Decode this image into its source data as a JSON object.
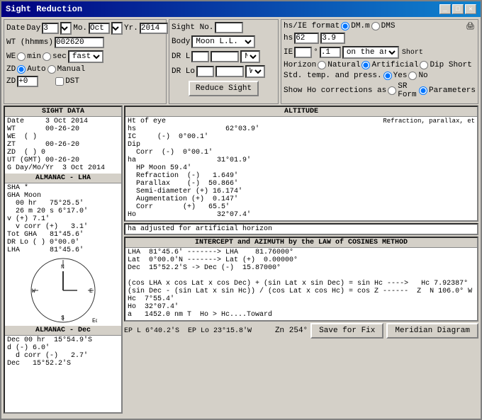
{
  "window": {
    "title": "Sight Reduction"
  },
  "form": {
    "date_label": "Date",
    "day_label": "Day",
    "day_value": "3",
    "mo_label": "Mo.",
    "mo_value": "Oct",
    "yr_label": "Yr.",
    "yr_value": "2014",
    "wt_label": "WT (hhmms)",
    "wt_value": "002620",
    "we_label": "WE",
    "min_label": "min",
    "sec_label": "sec",
    "fast_label": "fast",
    "zd_label": "ZD",
    "auto_label": "Auto",
    "manual_label": "Manual",
    "zd2_label": "ZD",
    "zd_value": "+0",
    "dst_label": "DST",
    "sight_no_label": "Sight No.",
    "body_label": "Body",
    "body_value": "Moon L.L.",
    "dr_l_label": "DR L",
    "dr_l_deg": "",
    "dr_l_dir": "N",
    "dr_lo_label": "DR Lo",
    "dr_lo_dir": "W",
    "reduce_btn": "Reduce Sight"
  },
  "hs_ie": {
    "format_label": "hs/IE format",
    "dm_m_label": "DM.m",
    "dms_label": "DMS",
    "hs_label": "hs",
    "hs_value": "62",
    "ie_deg": "",
    "ie_val": ".1",
    "on_arc_label": "on the arc",
    "short_label": "Short",
    "horizon_label": "Horizon",
    "natural_label": "Natural",
    "artificial_label": "Artificial",
    "dip_short_label": "Dip Short",
    "std_temp_label": "Std. temp. and press.",
    "yes_label": "Yes",
    "no_label": "No",
    "show_ho_label": "Show Ho corrections as",
    "sr_form_label": "SR Form",
    "parameters_label": "Parameters"
  },
  "sight_data": {
    "title": "SIGHT DATA",
    "date_label": "Date",
    "date_value": "3 Oct 2014",
    "wt_label": "WT",
    "wt_value": "00-26-20",
    "we_label": "WE",
    "we_value": "( )",
    "zt_label": "ZT",
    "zt_value": "00-26-20",
    "zd_label": "ZD",
    "zd_value": "( ) 0",
    "ut_label": "UT (GMT)",
    "ut_value": "00-26-20",
    "g_label": "G Day/Mo/Yr",
    "g_value": "3 Oct 2014"
  },
  "almanac_lha": {
    "title": "ALMANAC - LHA",
    "sha_label": "SHA *",
    "gha_label": "GHA Moon",
    "hr00_label": "00 hr",
    "hr00_value": "75°25.5'",
    "m26_label": "26 m 20 s",
    "m26_value": "6°17.0'",
    "v_plus_label": "v (+) 7.1'",
    "v_corr_label": "v corr (+)",
    "v_corr_value": "3.1'",
    "tot_gha_label": "Tot GHA",
    "tot_gha_value": "81°45.6'",
    "dr_lo_label": "DR Lo ( )",
    "dr_lo_value": "0°00.0'",
    "lha_label": "LHA",
    "lha_value": "81°45.6'"
  },
  "almanac_dec": {
    "title": "ALMANAC - Dec",
    "dec_00_label": "Dec 00 hr",
    "dec_00_value": "15°54.9'S",
    "d_label": "d (-) 6.0'",
    "d_corr_label": "d corr (-)",
    "d_corr_value": "2.7'",
    "dec_label": "Dec",
    "dec_value": "15°52.2'S"
  },
  "altitude": {
    "title": "ALTITUDE",
    "ht_of_eye_label": "Ht of eye",
    "refraction_label": "Refraction, parallax, et",
    "hs_label": "hs",
    "hs_value": "62°03.9'",
    "ic_label": "IC",
    "ic_sign": "(-)",
    "ic_value": "0°00.1'",
    "dip_label": "Dip",
    "corr_label": "Corr",
    "corr_sign": "(-)",
    "corr_value": "0°00.1'",
    "ha_label": "ha",
    "ha_value": "31°01.9'",
    "hp_moon_label": "HP Moon 59.4'",
    "refraction_row_label": "Refraction",
    "refraction_sign": "(-)",
    "refraction_val": "1.649'",
    "parallax_label": "Parallax",
    "parallax_sign": "(-)",
    "parallax_val": "50.866'",
    "semi_label": "Semi-diameter",
    "semi_sign": "(+)",
    "semi_val": "16.174'",
    "augment_label": "Augmentation",
    "augment_sign": "(+)",
    "augment_val": "0.147'",
    "corr2_label": "Corr",
    "corr2_sign": "(+)",
    "corr2_val": "65.5'",
    "ho_label": "Ho",
    "ho_value": "32°07.4'"
  },
  "adjusted_label": "ha adjusted for artificial horizon",
  "intercept": {
    "title": "INTERCEPT and AZIMUTH by the LAW of COSINES METHOD",
    "lha_row": "LHA  81°45.6' -------> LHA    81.76000°",
    "lat_row": "Lat  0°00.0'N -------> Lat (+)  0.00000°",
    "dec_row": "Dec  15°52.2'S -> Dec (-) 15.87000°",
    "formula1": "(cos LHA x cos Lat x cos Dec) + (sin Lat x sin Dec) = sin Hc ---->   Hc  7.92387°",
    "formula2": "(sin Dec - (sin Lat x sin Hc)) / (cos Lat x cos Hc) = cos Z ------> Z  N 106.0° W",
    "hc_label": "Hc  7°55.4'",
    "ho_label": "Ho  32°07.4'",
    "a_label": "a   1452.0 nm T  Ho > Hc....Toward",
    "zn_label": "Zn 254°",
    "ep_label": "EP L 6°40.2'S  EP Lo 23°15.8'W"
  },
  "buttons": {
    "save_label": "Save for Fix",
    "meridian_label": "Meridian Diagram"
  }
}
